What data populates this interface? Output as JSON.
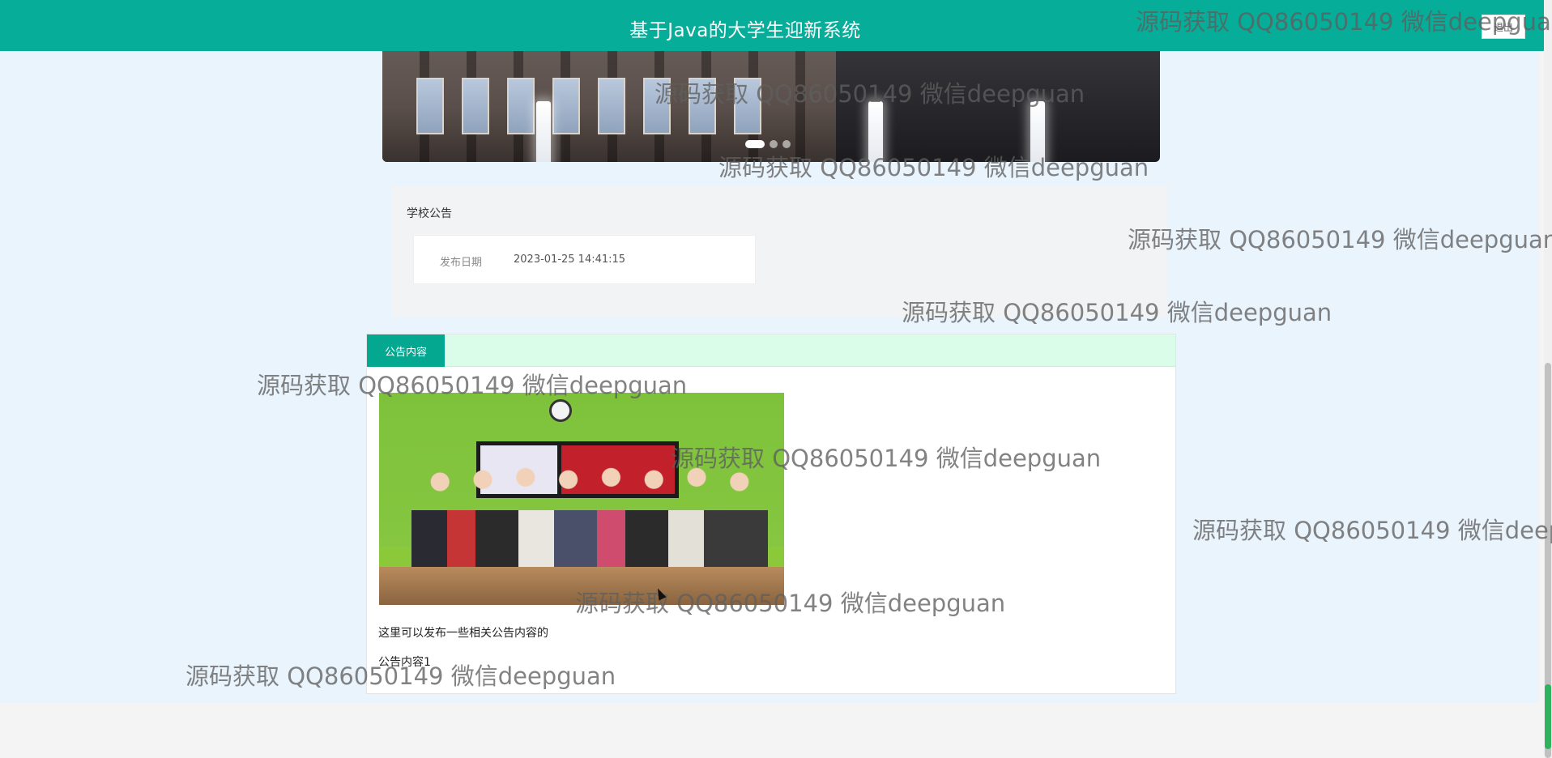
{
  "header": {
    "title": "基于Java的大学生迎新系统",
    "logout_label": "退出"
  },
  "carousel": {
    "slides": 3,
    "active_index": 0
  },
  "notice": {
    "section_title": "学校公告",
    "date_label": "发布日期",
    "date_value": "2023-01-25 14:41:15"
  },
  "content": {
    "tab_label": "公告内容",
    "text_line1": "这里可以发布一些相关公告内容的",
    "text_line2": "公告内容1"
  },
  "watermark": {
    "text": "源码获取 QQ86050149 微信deepguan"
  },
  "colors": {
    "header_bg": "#06ad98",
    "tab_bg": "#04a78f",
    "tabbar_bg": "#d9fde8",
    "page_bg": "#eaf4fd"
  }
}
